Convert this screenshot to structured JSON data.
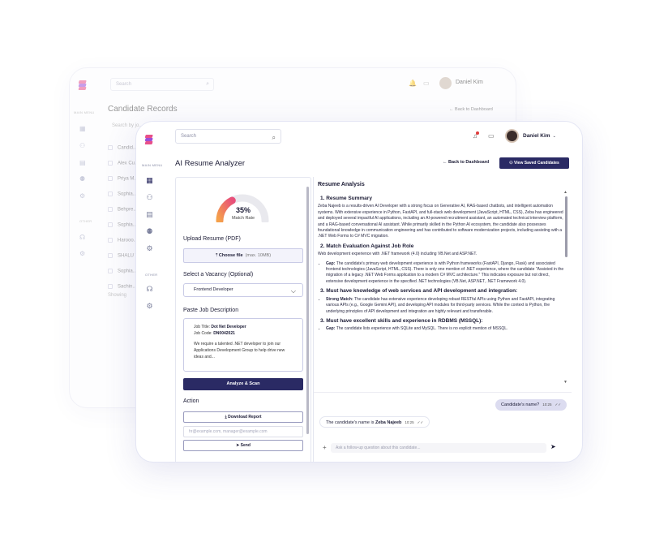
{
  "back_window": {
    "search_placeholder": "Search",
    "user_name": "Daniel Kim",
    "menu_label": "MAIN MENU",
    "other_label": "OTHER",
    "title": "Candidate Records",
    "back_link": "← Back to Dashboard",
    "search_by": "Search by jo...",
    "rows": [
      "Candid...",
      "Alex Cu...",
      "Priya M...",
      "Sophia...",
      "Behpre...",
      "Sophia...",
      "Harooo...",
      "SHALU T...",
      "Sophia...",
      "Sachin..."
    ],
    "showing": "Showing"
  },
  "topbar": {
    "search_placeholder": "Search",
    "user_name": "Daniel Kim",
    "user_caret": "⌄"
  },
  "sidebar": {
    "menu_label": "MAIN MENU",
    "other_label": "OTHER"
  },
  "header": {
    "title": "AI Resume Analyzer",
    "back_label": "Back to Dashboard",
    "saved_label": "View Saved Candidates"
  },
  "left": {
    "match_rate": 35,
    "match_rate_text": "35%",
    "match_rate_label": "Match Rate",
    "upload_label": "Upload Resume (PDF)",
    "choose_file_label": "Choose file",
    "choose_file_max": "(max. 10MB)",
    "vacancy_label": "Select a Vacancy (Optional)",
    "vacancy_value": "Frontend Developer",
    "jd_label": "Paste Job Description",
    "jd_line1_key": "Job Title: ",
    "jd_line1_val": "Dot Net Developer",
    "jd_line2_key": "Job Code: ",
    "jd_line2_val": "DN0042021",
    "jd_body": "We require a talented .NET developer to join our Applications Development Group to help drive new ideas and...",
    "analyze_label": "Analyze & Scan",
    "action_label": "Action",
    "download_label": "Download Report",
    "email_placeholder": "hr@example.com, manager@example.com",
    "send_label": "Send"
  },
  "analysis": {
    "title": "Resume Analysis",
    "s1_title": "1. Resume Summary",
    "s1_body": "Zeba Najeeb is a results-driven AI Developer with a strong focus on Generative AI, RAG-based chatbots, and intelligent automation systems. With extensive experience in Python, FastAPI, and full-stack web development (JavaScript, HTML, CSS), Zeba has engineered and deployed several impactful AI applications, including an AI-powered recruitment assistant, an automated technical interview platform, and a RAG-based conversational AI assistant. While primarily skilled in the Python AI ecosystem, the candidate also possesses foundational knowledge in communication engineering and has contributed to software modernization projects, including assisting with a .NET Web Forms to C# MVC migration.",
    "s2_title": "2. Match Evaluation Against Job Role",
    "s2_body": "Web development experience with .NET framework (4.0) including VB.Net and ASP.NET.",
    "s2_gap_key": "Gap: ",
    "s2_gap": "The candidate's primary web development experience is with Python frameworks (FastAPI, Django, Flask) and associated frontend technologies (JavaScript, HTML, CSS). There is only one mention of .NET experience, where the candidate \"Assisted in the migration of a legacy .NET Web Forms application to a modern C# MVC architecture.\" This indicates exposure but not direct, extensive development experience in the specified .NET technologies (VB.Net, ASP.NET, .NET Framework 4.0).",
    "s3_title": "3. Must have knowledge of web services and API development and integration:",
    "s3_key": "Strong Match: ",
    "s3_body": "The candidate has extensive experience developing robust RESTful APIs using Python and FastAPI, integrating various APIs (e.g., Google Gemini API), and developing API modules for third-party services. While the context is Python, the underlying principles of API development and integration are highly relevant and transferable.",
    "s4_title": "3. Must have excellent skills and experience in RDBMS (MSSQL):",
    "s4_key": "Gap: ",
    "s4_body": "The candidate lists experience with SQLite and MySQL. There is no explicit mention of MSSQL."
  },
  "chat": {
    "user_msg": "Candidate's name?",
    "user_time": "10:25",
    "bot_msg_prefix": "The candidate's name is ",
    "bot_msg_name": "Zeba Najeeb",
    "bot_time": "10:25",
    "input_placeholder": "Ask a follow-up question about this candidate..."
  },
  "colors": {
    "primary": "#2a2a64",
    "gauge_start": "#f5a04a",
    "gauge_end": "#e8507a",
    "gauge_track": "#e9e9ee"
  }
}
